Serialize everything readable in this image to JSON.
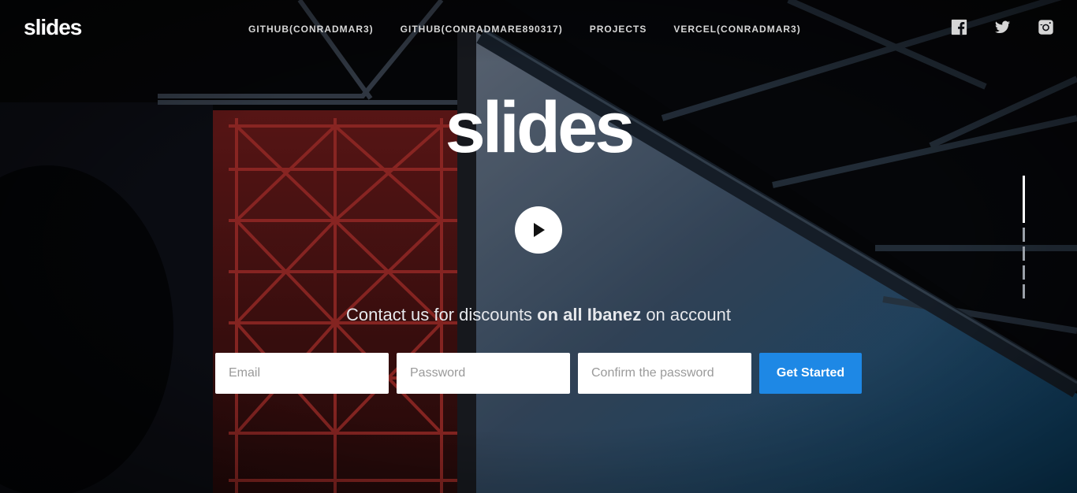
{
  "brand": {
    "logo_text": "slides"
  },
  "nav": {
    "items": [
      {
        "label": "GITHUB(CONRADMAR3)"
      },
      {
        "label": "GITHUB(CONRADMARE890317)"
      },
      {
        "label": "PROJECTS"
      },
      {
        "label": "VERCEL(CONRADMAR3)"
      }
    ]
  },
  "social": {
    "icons": [
      "facebook-icon",
      "twitter-icon",
      "instagram-icon"
    ]
  },
  "hero": {
    "title": "slides",
    "play_icon": "play-icon",
    "tagline_pre": "Contact us for discounts ",
    "tagline_bold": "on all Ibanez",
    "tagline_post": " on account"
  },
  "form": {
    "email_placeholder": "Email",
    "password_placeholder": "Password",
    "confirm_placeholder": "Confirm the password",
    "submit_label": "Get Started"
  },
  "slides": {
    "active_index": 0,
    "count": 5
  },
  "colors": {
    "accent": "#1e88e5",
    "text": "#ffffff",
    "sky": "#4a5a6e"
  }
}
